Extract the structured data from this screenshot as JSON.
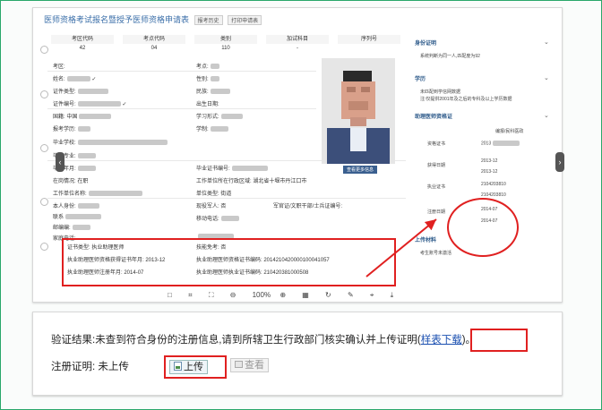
{
  "form": {
    "title": "医师资格考试报名暨授予医师资格申请表",
    "btn_history": "报考历史",
    "btn_print": "打印申请表",
    "columns": [
      "考区代码",
      "考点代码",
      "类别",
      "加试科目",
      "序列号"
    ],
    "row": [
      "42",
      "04",
      "110",
      "-",
      ""
    ],
    "fields": {
      "exam_area": "考区:",
      "exam_point": "考点:",
      "name": "姓名:",
      "gender": "性别:",
      "cert_type": "证件类型:",
      "ethnicity": "民族:",
      "cert_no": "证件编号:",
      "birth_date": "出生日期:",
      "nationality": "国籍:",
      "nationality_val": "中国",
      "edu_level": "学习形式:",
      "exam_edu": "报考学历:",
      "degree": "学制:",
      "graduate_school": "毕业学校:",
      "major": "毕业专业:",
      "grad_year": "毕业年月:",
      "grad_cert_no": "毕业证书编号:",
      "status": "在岗情况:",
      "status_val": "在职",
      "work_region": "工作单位所在行政区域:",
      "work_region_val": "湖北省十堰市丹江口市",
      "work_unit": "工作单位名称:",
      "unit_type": "单位类型:",
      "unit_type_val": "街道",
      "identity": "本人身份:",
      "current_soldier": "现役军人:",
      "current_soldier_val": "否",
      "military_cert": "军官证/文职干部/士兵证编号:",
      "contact": "联系",
      "mobile": "移动电话:",
      "postal": "邮编编:",
      "home_phone": "家庭电话:",
      "cert_kind": "证书类型:",
      "cert_kind_val": "执业助理医师",
      "trial": "技能免考:",
      "trial_val": "否",
      "asst_date": "执业助理医师资格获得证书年月:",
      "asst_date_val": "2013-12",
      "asst_cert_no": "执业助理医师资格证书编码:",
      "asst_cert_no_val": "2014210420000100041057",
      "asst_reg_date": "执业助理医师注册年月:",
      "asst_reg_date_val": "2014-07",
      "asst_practice_no": "执业助理医师执业证书编码:",
      "asst_practice_no_val": "210420381000508",
      "more_btn": "查看更多信息"
    },
    "toolbar_zoom": "100%"
  },
  "right_panel": {
    "id_title": "身份证明",
    "id_text": "系统判断为同一人,匹配度为92",
    "edu_title": "学历",
    "edu_text1": "未匹配到学信网数据",
    "edu_text2": "注:仅提供2001年及之后的专科及以上学历数据",
    "asst_title": "助理医师资格证",
    "col_hdr": "编报/民科医政",
    "cert_label": "资格证书",
    "cert_val": "2013",
    "obtain_label": "获得日期",
    "obtain_val1": "2013-12",
    "obtain_val2": "2013-12",
    "practice_label": "执业证书",
    "practice_val1": "2104203810",
    "practice_val2": "2104203810",
    "reg_label": "注册日期",
    "reg_val1": "2014-07",
    "reg_val2": "2014-07",
    "upload_title": "上传材料",
    "upload_text": "考生账号未激活"
  },
  "result": {
    "verify_prefix": "验证结果:未查到符合身份的注册信息,请到所辖卫生行政部门核实确认并上传证明(",
    "sample_link": "样表下载",
    "verify_suffix": ")。",
    "reg_label": "注册证明: 未上传",
    "upload_btn": "上传",
    "view_btn": "查看"
  },
  "colors": {
    "highlight_red": "#e02020",
    "frame_green": "#2aa86a",
    "link_blue": "#1a4fb0"
  }
}
